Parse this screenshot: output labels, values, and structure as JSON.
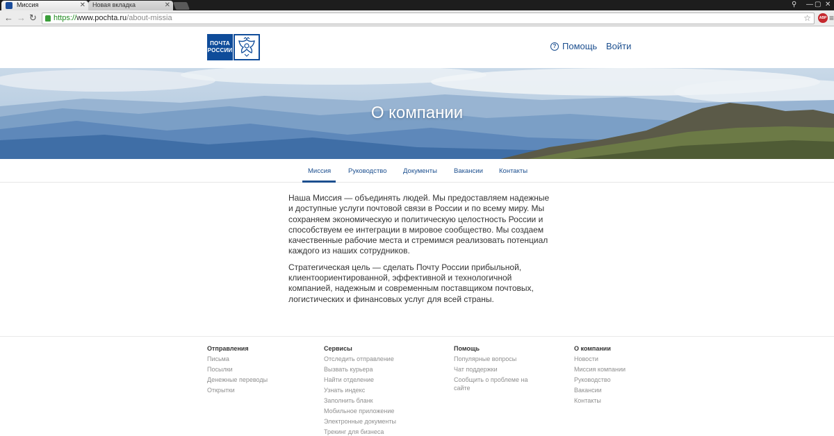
{
  "browser": {
    "tabs": [
      {
        "label": "Миссия",
        "active": true
      },
      {
        "label": "Новая вкладка",
        "active": false
      }
    ],
    "url": {
      "scheme": "https://",
      "host": "www.pochta.ru",
      "path": "/about-missia"
    },
    "adblock_badge": "ABP"
  },
  "header": {
    "logo": {
      "line1": "ПОЧТА",
      "line2": "РОССИИ"
    },
    "help_label": "Помощь",
    "login_label": "Войти"
  },
  "hero": {
    "title": "О компании"
  },
  "subnav": [
    {
      "label": "Миссия",
      "active": true
    },
    {
      "label": "Руководство",
      "active": false
    },
    {
      "label": "Документы",
      "active": false
    },
    {
      "label": "Вакансии",
      "active": false
    },
    {
      "label": "Контакты",
      "active": false
    }
  ],
  "content": {
    "paragraph1": "Наша Миссия — объединять людей. Мы предоставляем надежные и доступные услуги почтовой связи в России и по всему миру. Мы сохраняем экономическую и политическую целостность России и способствуем ее интеграции в мировое сообщество. Мы создаем качественные рабочие места и стремимся реализовать потенциал каждого из наших сотрудников.",
    "paragraph2": "Стратегическая цель — сделать Почту России прибыльной, клиентоориентированной, эффективной и технологичной компанией, надежным и современным поставщиком почтовых, логистических и финансовых услуг для всей страны."
  },
  "footer": {
    "columns": [
      {
        "heading": "Отправления",
        "links": [
          "Письма",
          "Посылки",
          "Денежные переводы",
          "Открытки"
        ]
      },
      {
        "heading": "Сервисы",
        "links": [
          "Отследить отправление",
          "Вызвать курьера",
          "Найти отделение",
          "Узнать индекс",
          "Заполнить бланк",
          "Мобильное приложение",
          "Электронные документы",
          "Трекинг для бизнеса"
        ]
      },
      {
        "heading": "Помощь",
        "links": [
          "Популярные вопросы",
          "Чат поддержки",
          "Сообщить о проблеме на сайте"
        ]
      },
      {
        "heading": "О компании",
        "links": [
          "Новости",
          "Миссия компании",
          "Руководство",
          "Вакансии",
          "Контакты"
        ]
      }
    ]
  },
  "colors": {
    "brand_blue": "#0f4c9a",
    "link_blue": "#1c4f8f",
    "footer_link_gray": "#8f8f8f"
  },
  "icons": [
    "tab-favicon-icon",
    "tab-close-icon",
    "back-icon",
    "forward-icon",
    "reload-icon",
    "lock-icon",
    "star-icon",
    "chrome-menu-icon",
    "help-icon",
    "eagle-emblem-icon"
  ]
}
